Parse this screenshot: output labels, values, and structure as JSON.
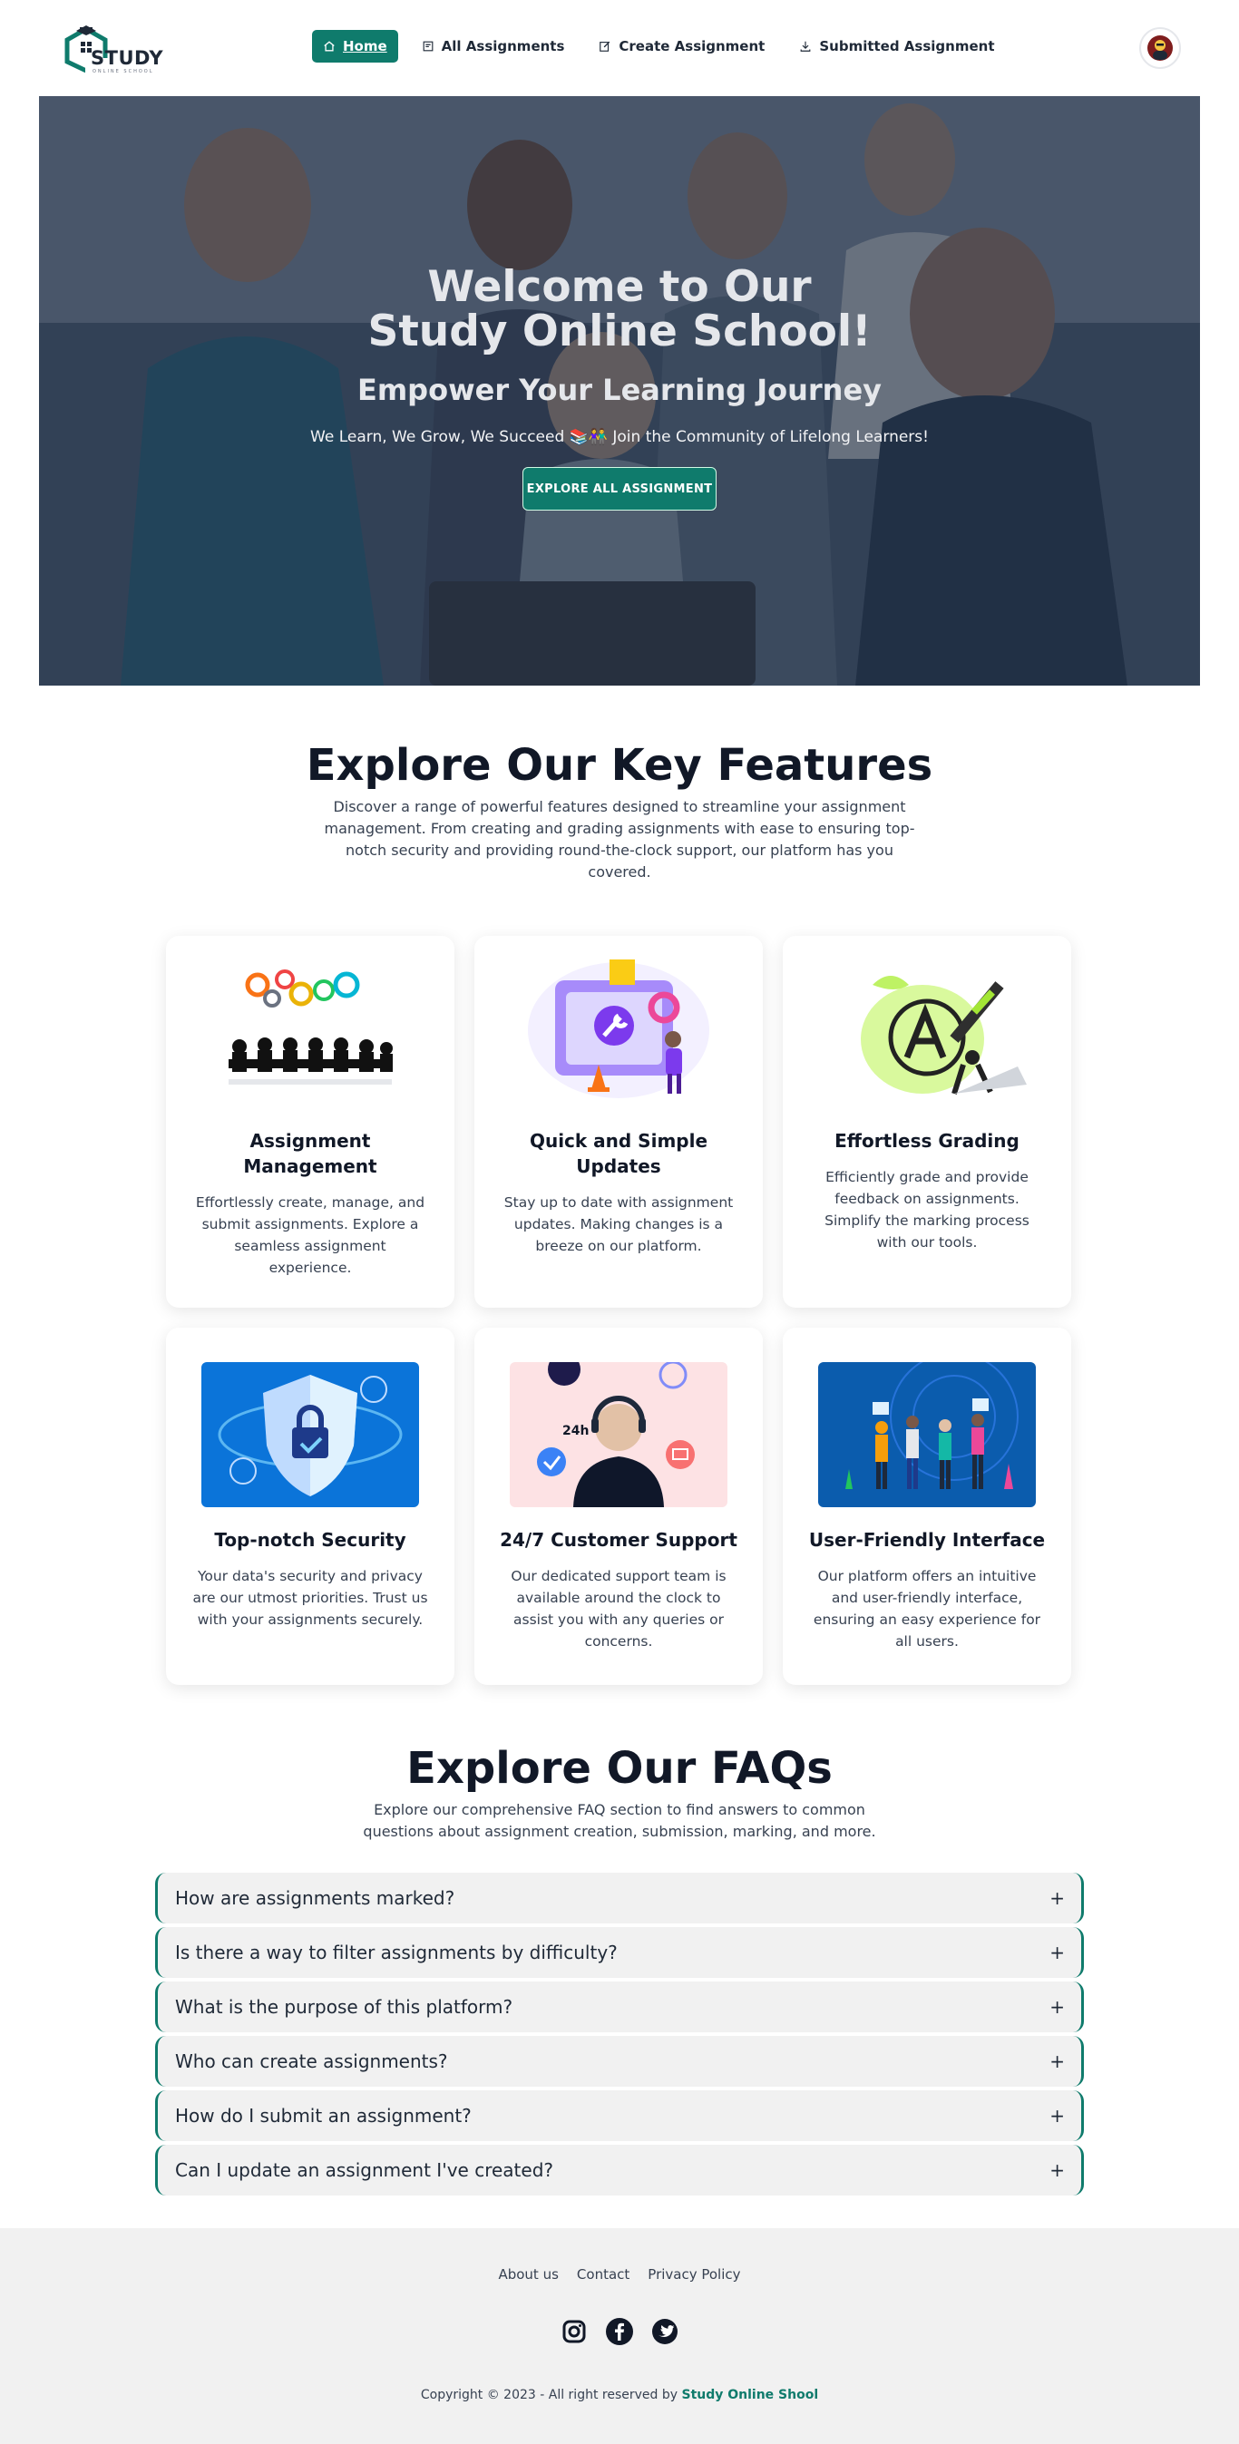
{
  "brand": {
    "logo_text": "STUDY",
    "logo_subtext": "ONLINE SCHOOL",
    "accent_color": "#0f7b6c"
  },
  "nav": {
    "items": [
      {
        "label": "Home",
        "icon": "home-icon",
        "active": true
      },
      {
        "label": "All Assignments",
        "icon": "list-icon",
        "active": false
      },
      {
        "label": "Create Assignment",
        "icon": "edit-icon",
        "active": false
      },
      {
        "label": "Submitted Assignment",
        "icon": "download-icon",
        "active": false
      }
    ],
    "avatar_icon": "user-avatar"
  },
  "hero": {
    "title_line1": "Welcome to Our",
    "title_line2": "Study Online School!",
    "subtitle": "Empower Your Learning Journey",
    "tagline": "We Learn, We Grow, We Succeed 📚👫 Join the Community of Lifelong Learners!",
    "button_label": "EXPLORE ALL ASSIGNMENT"
  },
  "features": {
    "title": "Explore Our Key Features",
    "description": "Discover a range of powerful features designed to streamline your assignment management. From creating and grading assignments with ease to ensuring top-notch security and providing round-the-clock support, our platform has you covered.",
    "cards": [
      {
        "title": "Assignment Management",
        "text": "Effortlessly create, manage, and submit assignments. Explore a seamless assignment experience.",
        "image": "team-gears-illustration"
      },
      {
        "title": "Quick and Simple Updates",
        "text": "Stay up to date with assignment updates. Making changes is a breeze on our platform.",
        "image": "update-tools-illustration"
      },
      {
        "title": "Effortless Grading",
        "text": "Efficiently grade and provide feedback on assignments. Simplify the marking process with our tools.",
        "image": "grading-pen-illustration"
      },
      {
        "title": "Top-notch Security",
        "text": "Your data's security and privacy are our utmost priorities. Trust us with your assignments securely.",
        "image": "security-shield-illustration"
      },
      {
        "title": "24/7 Customer Support",
        "text": "Our dedicated support team is available around the clock to assist you with any queries or concerns.",
        "image": "support-agent-illustration",
        "image_label": "24h"
      },
      {
        "title": "User-Friendly Interface",
        "text": "Our platform offers an intuitive and user-friendly interface, ensuring an easy experience for all users.",
        "image": "interface-people-illustration"
      }
    ]
  },
  "faq": {
    "title": "Explore Our FAQs",
    "description": "Explore our comprehensive FAQ section to find answers to common questions about assignment creation, submission, marking, and more.",
    "items": [
      {
        "question": "How are assignments marked?",
        "toggle": "+"
      },
      {
        "question": "Is there a way to filter assignments by difficulty?",
        "toggle": "+"
      },
      {
        "question": "What is the purpose of this platform?",
        "toggle": "+"
      },
      {
        "question": "Who can create assignments?",
        "toggle": "+"
      },
      {
        "question": "How do I submit an assignment?",
        "toggle": "+"
      },
      {
        "question": "Can I update an assignment I've created?",
        "toggle": "+"
      }
    ]
  },
  "footer": {
    "links": [
      "About us",
      "Contact",
      "Privacy Policy"
    ],
    "socials": [
      "instagram-icon",
      "facebook-icon",
      "twitter-icon"
    ],
    "copyright_prefix": "Copyright © 2023 - All right reserved by",
    "copyright_brand": "Study Online Shool"
  }
}
